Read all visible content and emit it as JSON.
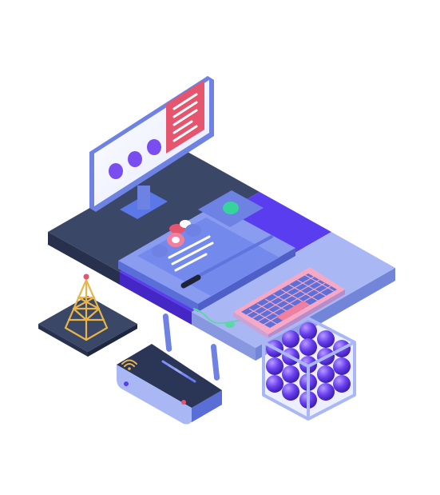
{
  "illustration": {
    "palette": {
      "background": "#ffffff",
      "platform_dark": "#3a4766",
      "platform_purple": "#5b3df0",
      "platform_light": "#a9b8f5",
      "device_blue": "#8a9cf0",
      "device_edge": "#6d82e3",
      "screen_white": "#f2f4ff",
      "accent_red": "#e5556d",
      "accent_pink": "#f07fa0",
      "accent_green": "#36d39c",
      "dot_purple": "#7a4df0",
      "tower_gold": "#e8b54a",
      "cube_sphere": "#6a3ff0",
      "cable_green": "#5fd6a8"
    },
    "objects": [
      {
        "name": "monitor",
        "icon": "monitor-icon"
      },
      {
        "name": "tablet-ui-panel",
        "icon": "tablet-icon"
      },
      {
        "name": "keyboard",
        "icon": "keyboard-icon"
      },
      {
        "name": "router",
        "icon": "wifi-router-icon"
      },
      {
        "name": "cell-tower",
        "icon": "antenna-tower-icon"
      },
      {
        "name": "data-cube",
        "icon": "sphere-cube-icon"
      }
    ]
  }
}
